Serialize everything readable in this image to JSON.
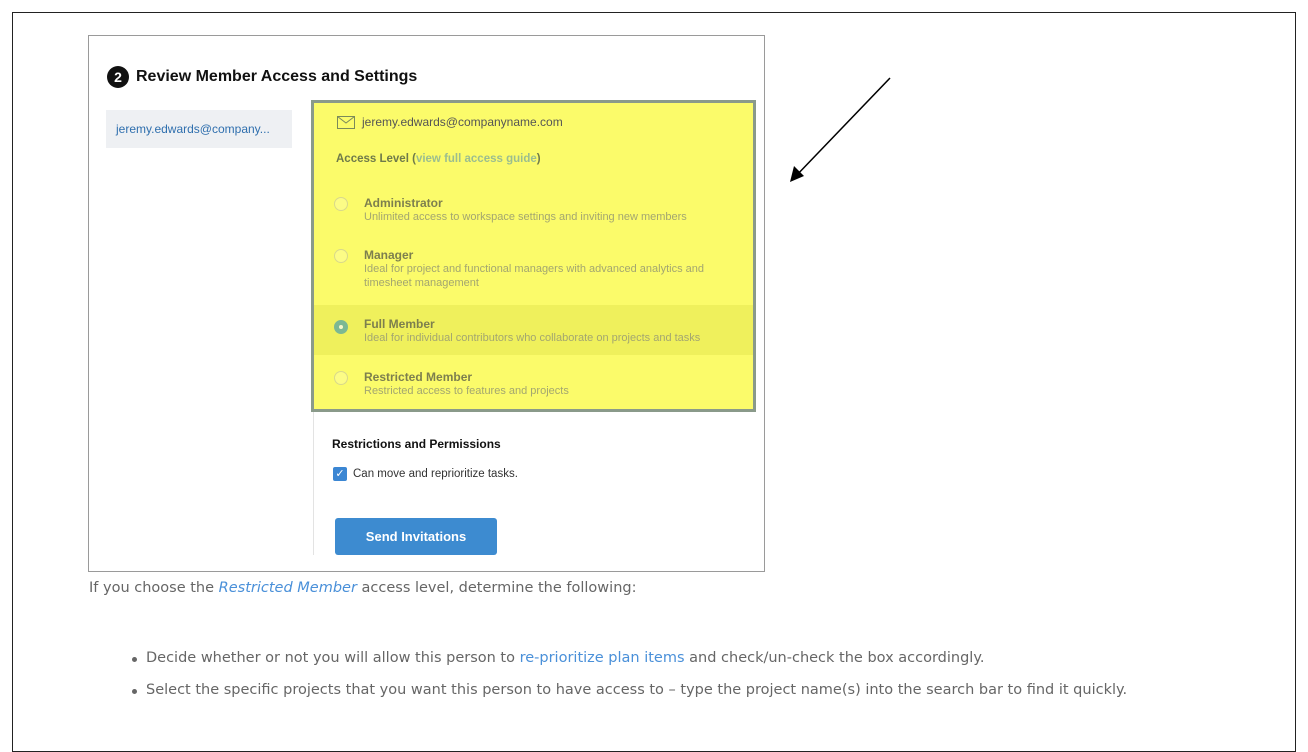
{
  "step": {
    "number": "2",
    "title": "Review Member Access and Settings"
  },
  "members": [
    {
      "label": "jeremy.edwards@company..."
    }
  ],
  "email": "jeremy.edwards@companyname.com",
  "access": {
    "label": "Access Level",
    "open_paren": "(",
    "guide_link": "view full access guide",
    "close_paren": ")"
  },
  "options": [
    {
      "title": "Administrator",
      "desc": "Unlimited access to workspace settings and inviting new members",
      "selected": false
    },
    {
      "title": "Manager",
      "desc": "Ideal for project and functional managers with advanced analytics and timesheet management",
      "selected": false
    },
    {
      "title": "Full Member",
      "desc": "Ideal for individual contributors who collaborate on projects and tasks",
      "selected": true
    },
    {
      "title": "Restricted Member",
      "desc": "Restricted access to features and projects",
      "selected": false
    }
  ],
  "restrictions": {
    "title": "Restrictions and Permissions",
    "checkbox_label": "Can move and reprioritize tasks.",
    "checked": true
  },
  "send_button": "Send Invitations",
  "paragraph": {
    "before": "If you choose the ",
    "emphasis": "Restricted Member",
    "after": " access level, determine the following:"
  },
  "bullets": [
    {
      "before": "Decide whether or not you will allow this person to ",
      "link": "re-prioritize plan items",
      "after": " and check/un-check the box accordingly."
    },
    {
      "before": "Select the specific projects that you want this person to have access to – type the project name(s) into the search bar to find it quickly.",
      "link": "",
      "after": ""
    }
  ],
  "icons": {
    "mail": "mail-icon",
    "checkmark": "checkmark-icon",
    "arrow": "arrow-annotation-icon"
  },
  "colors": {
    "highlight": "#fbfb6a",
    "accent": "#3d8bd0",
    "link": "#4a90d9"
  }
}
